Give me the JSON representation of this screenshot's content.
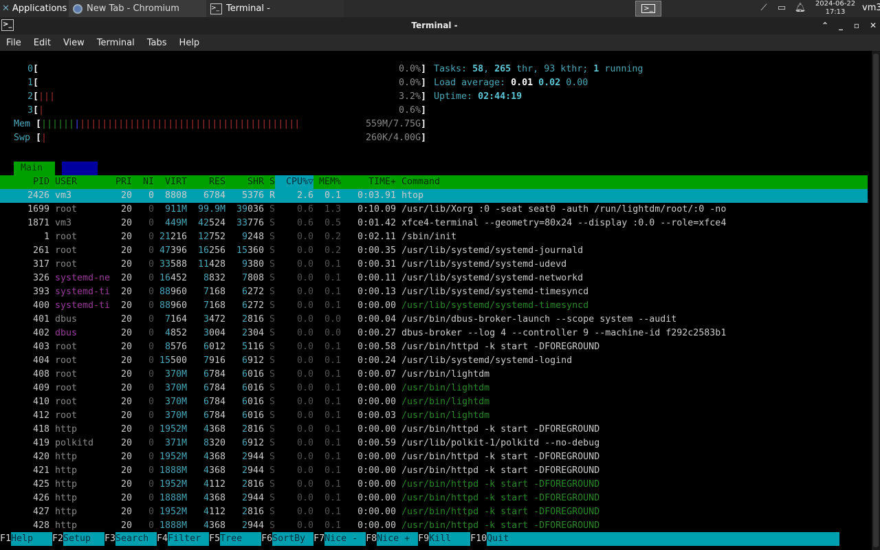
{
  "panel": {
    "applications": "Applications",
    "tasks": [
      {
        "label": "New Tab - Chromium"
      },
      {
        "label": "Terminal -"
      }
    ],
    "clock_date": "2024-06-22",
    "clock_time": "17:13",
    "user": "vm3"
  },
  "window": {
    "title": "Terminal -",
    "menu": [
      "File",
      "Edit",
      "View",
      "Terminal",
      "Tabs",
      "Help"
    ]
  },
  "htop": {
    "cpus": [
      {
        "id": "0",
        "value": "0.0%"
      },
      {
        "id": "1",
        "value": "0.0%"
      },
      {
        "id": "2",
        "value": "3.2%"
      },
      {
        "id": "3",
        "value": "0.6%"
      }
    ],
    "mem_label": "Mem",
    "mem_value": "559M/7.75G",
    "swp_label": "Swp",
    "swp_value": "260K/4.00G",
    "tasks_label": "Tasks:",
    "tasks": "58",
    "threads": "265",
    "thr_label": "thr,",
    "kthreads": "93",
    "kthr_label": "kthr;",
    "running": "1",
    "running_label": "running",
    "load_label": "Load average:",
    "load1": "0.01",
    "load5": "0.02",
    "load15": "0.00",
    "uptime_label": "Uptime:",
    "uptime": "02:44:19",
    "tab_main": "Main",
    "columns": [
      "PID",
      "USER",
      "PRI",
      "NI",
      "VIRT",
      "RES",
      "SHR",
      "S",
      "CPU%▽",
      "MEM%",
      "TIME+",
      "Command"
    ],
    "rows": [
      {
        "pid": "2426",
        "user": "vm3",
        "pri": "20",
        "ni": "0",
        "virt": "8808",
        "res": "6784",
        "shr": "5376",
        "s": "R",
        "cpu": "2.6",
        "mem": "0.1",
        "time": "0:03.91",
        "cmd": "htop",
        "selected": true
      },
      {
        "pid": "1699",
        "user": "root",
        "pri": "20",
        "ni": "0",
        "virt": "911M",
        "res": "99.9M",
        "shr": "39036",
        "s": "S",
        "cpu": "0.6",
        "mem": "1.3",
        "time": "0:10.09",
        "cmd": "/usr/lib/Xorg :0 -seat seat0 -auth /run/lightdm/root/:0 -no"
      },
      {
        "pid": "1871",
        "user": "vm3",
        "pri": "20",
        "ni": "0",
        "virt": "449M",
        "res": "42524",
        "shr": "33776",
        "s": "S",
        "cpu": "0.6",
        "mem": "0.5",
        "time": "0:01.42",
        "cmd": "xfce4-terminal --geometry=80x24 --display :0.0 --role=xfce4"
      },
      {
        "pid": "1",
        "user": "root",
        "pri": "20",
        "ni": "0",
        "virt": "21216",
        "res": "12752",
        "shr": "9248",
        "s": "S",
        "cpu": "0.0",
        "mem": "0.2",
        "time": "0:02.11",
        "cmd": "/sbin/init"
      },
      {
        "pid": "261",
        "user": "root",
        "pri": "20",
        "ni": "0",
        "virt": "47396",
        "res": "16256",
        "shr": "15360",
        "s": "S",
        "cpu": "0.0",
        "mem": "0.2",
        "time": "0:00.35",
        "cmd": "/usr/lib/systemd/systemd-journald"
      },
      {
        "pid": "317",
        "user": "root",
        "pri": "20",
        "ni": "0",
        "virt": "33588",
        "res": "11428",
        "shr": "9380",
        "s": "S",
        "cpu": "0.0",
        "mem": "0.1",
        "time": "0:00.31",
        "cmd": "/usr/lib/systemd/systemd-udevd"
      },
      {
        "pid": "326",
        "user": "systemd-ne",
        "pri": "20",
        "ni": "0",
        "virt": "16452",
        "res": "8832",
        "shr": "7808",
        "s": "S",
        "cpu": "0.0",
        "mem": "0.1",
        "time": "0:00.11",
        "cmd": "/usr/lib/systemd/systemd-networkd",
        "user_mag": true
      },
      {
        "pid": "393",
        "user": "systemd-ti",
        "pri": "20",
        "ni": "0",
        "virt": "88960",
        "res": "7168",
        "shr": "6272",
        "s": "S",
        "cpu": "0.0",
        "mem": "0.1",
        "time": "0:00.13",
        "cmd": "/usr/lib/systemd/systemd-timesyncd",
        "user_mag": true
      },
      {
        "pid": "400",
        "user": "systemd-ti",
        "pri": "20",
        "ni": "0",
        "virt": "88960",
        "res": "7168",
        "shr": "6272",
        "s": "S",
        "cpu": "0.0",
        "mem": "0.1",
        "time": "0:00.00",
        "cmd": "/usr/lib/systemd/systemd-timesyncd",
        "user_mag": true,
        "thread": true
      },
      {
        "pid": "401",
        "user": "dbus",
        "pri": "20",
        "ni": "0",
        "virt": "7164",
        "res": "3472",
        "shr": "2816",
        "s": "S",
        "cpu": "0.0",
        "mem": "0.0",
        "time": "0:00.04",
        "cmd": "/usr/bin/dbus-broker-launch --scope system --audit"
      },
      {
        "pid": "402",
        "user": "dbus",
        "pri": "20",
        "ni": "0",
        "virt": "4852",
        "res": "3004",
        "shr": "2304",
        "s": "S",
        "cpu": "0.0",
        "mem": "0.0",
        "time": "0:00.27",
        "cmd": "dbus-broker --log 4 --controller 9 --machine-id f292c2583b1",
        "user_mag": true
      },
      {
        "pid": "403",
        "user": "root",
        "pri": "20",
        "ni": "0",
        "virt": "8576",
        "res": "6012",
        "shr": "5116",
        "s": "S",
        "cpu": "0.0",
        "mem": "0.1",
        "time": "0:00.58",
        "cmd": "/usr/bin/httpd -k start -DFOREGROUND"
      },
      {
        "pid": "404",
        "user": "root",
        "pri": "20",
        "ni": "0",
        "virt": "15500",
        "res": "7916",
        "shr": "6912",
        "s": "S",
        "cpu": "0.0",
        "mem": "0.1",
        "time": "0:00.24",
        "cmd": "/usr/lib/systemd/systemd-logind"
      },
      {
        "pid": "408",
        "user": "root",
        "pri": "20",
        "ni": "0",
        "virt": "370M",
        "res": "6784",
        "shr": "6016",
        "s": "S",
        "cpu": "0.0",
        "mem": "0.1",
        "time": "0:00.07",
        "cmd": "/usr/bin/lightdm"
      },
      {
        "pid": "409",
        "user": "root",
        "pri": "20",
        "ni": "0",
        "virt": "370M",
        "res": "6784",
        "shr": "6016",
        "s": "S",
        "cpu": "0.0",
        "mem": "0.1",
        "time": "0:00.00",
        "cmd": "/usr/bin/lightdm",
        "thread": true
      },
      {
        "pid": "410",
        "user": "root",
        "pri": "20",
        "ni": "0",
        "virt": "370M",
        "res": "6784",
        "shr": "6016",
        "s": "S",
        "cpu": "0.0",
        "mem": "0.1",
        "time": "0:00.00",
        "cmd": "/usr/bin/lightdm",
        "thread": true
      },
      {
        "pid": "412",
        "user": "root",
        "pri": "20",
        "ni": "0",
        "virt": "370M",
        "res": "6784",
        "shr": "6016",
        "s": "S",
        "cpu": "0.0",
        "mem": "0.1",
        "time": "0:00.03",
        "cmd": "/usr/bin/lightdm",
        "thread": true
      },
      {
        "pid": "418",
        "user": "http",
        "pri": "20",
        "ni": "0",
        "virt": "1952M",
        "res": "4368",
        "shr": "2816",
        "s": "S",
        "cpu": "0.0",
        "mem": "0.1",
        "time": "0:00.00",
        "cmd": "/usr/bin/httpd -k start -DFOREGROUND"
      },
      {
        "pid": "419",
        "user": "polkitd",
        "pri": "20",
        "ni": "0",
        "virt": "371M",
        "res": "8320",
        "shr": "6912",
        "s": "S",
        "cpu": "0.0",
        "mem": "0.1",
        "time": "0:00.59",
        "cmd": "/usr/lib/polkit-1/polkitd --no-debug"
      },
      {
        "pid": "420",
        "user": "http",
        "pri": "20",
        "ni": "0",
        "virt": "1952M",
        "res": "4368",
        "shr": "2944",
        "s": "S",
        "cpu": "0.0",
        "mem": "0.1",
        "time": "0:00.00",
        "cmd": "/usr/bin/httpd -k start -DFOREGROUND"
      },
      {
        "pid": "421",
        "user": "http",
        "pri": "20",
        "ni": "0",
        "virt": "1888M",
        "res": "4368",
        "shr": "2944",
        "s": "S",
        "cpu": "0.0",
        "mem": "0.1",
        "time": "0:00.00",
        "cmd": "/usr/bin/httpd -k start -DFOREGROUND"
      },
      {
        "pid": "425",
        "user": "http",
        "pri": "20",
        "ni": "0",
        "virt": "1952M",
        "res": "4112",
        "shr": "2816",
        "s": "S",
        "cpu": "0.0",
        "mem": "0.1",
        "time": "0:00.00",
        "cmd": "/usr/bin/httpd -k start -DFOREGROUND",
        "thread": true
      },
      {
        "pid": "426",
        "user": "http",
        "pri": "20",
        "ni": "0",
        "virt": "1888M",
        "res": "4368",
        "shr": "2944",
        "s": "S",
        "cpu": "0.0",
        "mem": "0.1",
        "time": "0:00.00",
        "cmd": "/usr/bin/httpd -k start -DFOREGROUND",
        "thread": true
      },
      {
        "pid": "427",
        "user": "http",
        "pri": "20",
        "ni": "0",
        "virt": "1952M",
        "res": "4112",
        "shr": "2816",
        "s": "S",
        "cpu": "0.0",
        "mem": "0.1",
        "time": "0:00.00",
        "cmd": "/usr/bin/httpd -k start -DFOREGROUND",
        "thread": true
      },
      {
        "pid": "428",
        "user": "http",
        "pri": "20",
        "ni": "0",
        "virt": "1888M",
        "res": "4368",
        "shr": "2944",
        "s": "S",
        "cpu": "0.0",
        "mem": "0.1",
        "time": "0:00.00",
        "cmd": "/usr/bin/httpd -k start -DFOREGROUND",
        "thread": true
      }
    ],
    "fkeys": [
      {
        "key": "F1",
        "label": "Help  "
      },
      {
        "key": "F2",
        "label": "Setup "
      },
      {
        "key": "F3",
        "label": "Search"
      },
      {
        "key": "F4",
        "label": "Filter"
      },
      {
        "key": "F5",
        "label": "Tree  "
      },
      {
        "key": "F6",
        "label": "SortBy"
      },
      {
        "key": "F7",
        "label": "Nice -"
      },
      {
        "key": "F8",
        "label": "Nice +"
      },
      {
        "key": "F9",
        "label": "Kill  "
      },
      {
        "key": "F10",
        "label": "Quit"
      }
    ]
  }
}
